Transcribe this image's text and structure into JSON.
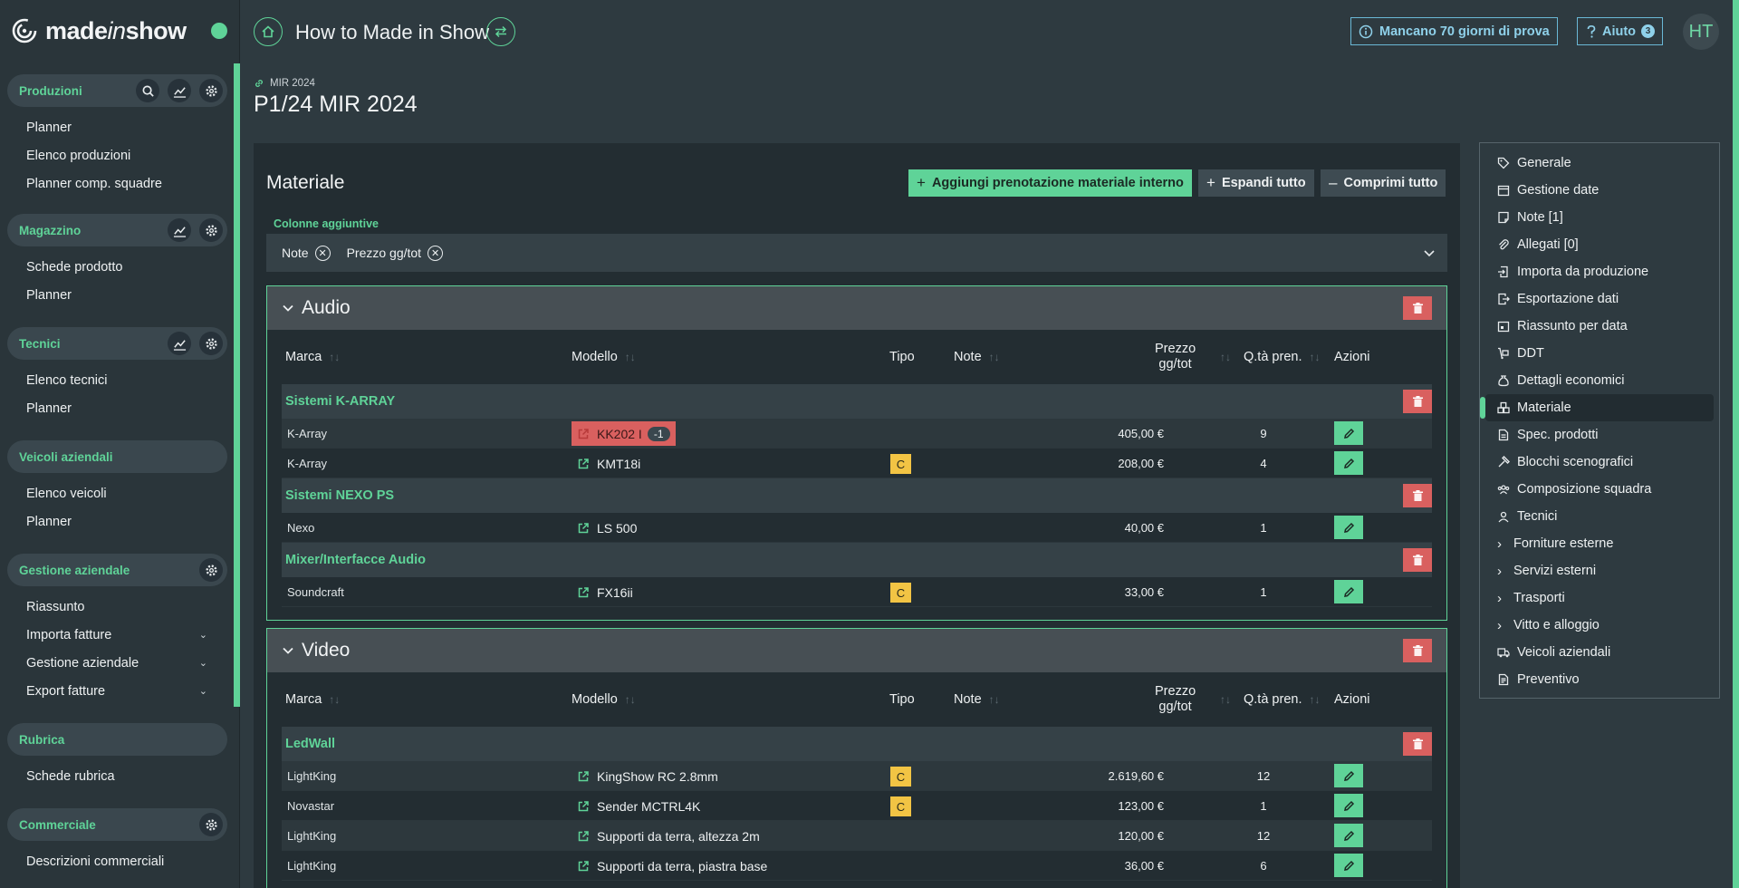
{
  "brand": {
    "name_part1": "made",
    "name_italic": "in",
    "name_part2": "show"
  },
  "topbar": {
    "title": "How to Made in Show",
    "trial_text": "Mancano 70 giorni di prova",
    "help_label": "Aiuto",
    "help_count": "3",
    "avatar_initials": "HT"
  },
  "sidebar": {
    "groups": [
      {
        "title": "Produzioni",
        "items": [
          "Planner",
          "Elenco produzioni",
          "Planner comp. squadre"
        ]
      },
      {
        "title": "Magazzino",
        "items": [
          "Schede prodotto",
          "Planner"
        ]
      },
      {
        "title": "Tecnici",
        "items": [
          "Elenco tecnici",
          "Planner"
        ]
      },
      {
        "title": "Veicoli aziendali",
        "items": [
          "Elenco veicoli",
          "Planner"
        ]
      },
      {
        "title": "Gestione aziendale",
        "items": [
          "Riassunto",
          "Importa fatture",
          "Gestione aziendale",
          "Export fatture"
        ]
      },
      {
        "title": "Rubrica",
        "items": [
          "Schede rubrica"
        ]
      },
      {
        "title": "Commerciale",
        "items": [
          "Descrizioni commerciali"
        ]
      }
    ]
  },
  "page": {
    "breadcrumb": "MIR 2024",
    "title": "P1/24 MIR 2024"
  },
  "main": {
    "title": "Materiale",
    "add_button": "Aggiungi prenotazione materiale interno",
    "expand_button": "Espandi tutto",
    "collapse_button": "Comprimi tutto",
    "columns_label": "Colonne aggiuntive",
    "columns": [
      "Note",
      "Prezzo gg/tot"
    ]
  },
  "table_headers": {
    "marca": "Marca",
    "modello": "Modello",
    "tipo": "Tipo",
    "note": "Note",
    "prezzo_line1": "Prezzo",
    "prezzo_line2": "gg/tot",
    "qta": "Q.tà pren.",
    "azioni": "Azioni"
  },
  "sections": [
    {
      "title": "Audio",
      "groups": [
        {
          "name": "Sistemi K-ARRAY",
          "rows": [
            {
              "brand": "K-Array",
              "model": "KK202 I",
              "warn": "-1",
              "tipo": "",
              "price": "405,00 €",
              "qty": "9"
            },
            {
              "brand": "K-Array",
              "model": "KMT18i",
              "tipo": "C",
              "price": "208,00 €",
              "qty": "4"
            }
          ]
        },
        {
          "name": "Sistemi NEXO PS",
          "rows": [
            {
              "brand": "Nexo",
              "model": "LS 500",
              "tipo": "",
              "price": "40,00 €",
              "qty": "1"
            }
          ]
        },
        {
          "name": "Mixer/Interfacce Audio",
          "rows": [
            {
              "brand": "Soundcraft",
              "model": "FX16ii",
              "tipo": "C",
              "price": "33,00 €",
              "qty": "1"
            }
          ]
        }
      ]
    },
    {
      "title": "Video",
      "groups": [
        {
          "name": "LedWall",
          "rows": [
            {
              "brand": "LightKing",
              "model": "KingShow RC 2.8mm",
              "tipo": "C",
              "price": "2.619,60 €",
              "qty": "12"
            },
            {
              "brand": "Novastar",
              "model": "Sender MCTRL4K",
              "tipo": "C",
              "price": "123,00 €",
              "qty": "1"
            },
            {
              "brand": "LightKing",
              "model": "Supporti da terra, altezza 2m",
              "tipo": "",
              "price": "120,00 €",
              "qty": "12"
            },
            {
              "brand": "LightKing",
              "model": "Supporti da terra, piastra base",
              "tipo": "",
              "price": "36,00 €",
              "qty": "6"
            }
          ]
        }
      ]
    }
  ],
  "right_nav": [
    {
      "label": "Generale",
      "icon": "tag-icon"
    },
    {
      "label": "Gestione date",
      "icon": "calendar-icon"
    },
    {
      "label": "Note [1]",
      "icon": "note-icon"
    },
    {
      "label": "Allegati [0]",
      "icon": "paperclip-icon"
    },
    {
      "label": "Importa da produzione",
      "icon": "import-icon"
    },
    {
      "label": "Esportazione dati",
      "icon": "export-icon"
    },
    {
      "label": "Riassunto per data",
      "icon": "calendar-summary-icon"
    },
    {
      "label": "DDT",
      "icon": "dolly-icon"
    },
    {
      "label": "Dettagli economici",
      "icon": "moneybag-icon"
    },
    {
      "label": "Materiale",
      "icon": "boxes-icon",
      "active": true
    },
    {
      "label": "Spec. prodotti",
      "icon": "document-icon"
    },
    {
      "label": "Blocchi scenografici",
      "icon": "hammer-icon"
    },
    {
      "label": "Composizione squadra",
      "icon": "team-icon"
    },
    {
      "label": "Tecnici",
      "icon": "worker-icon"
    },
    {
      "label": "Forniture esterne",
      "icon": "chevron-right-icon"
    },
    {
      "label": "Servizi esterni",
      "icon": "chevron-right-icon"
    },
    {
      "label": "Trasporti",
      "icon": "chevron-right-icon"
    },
    {
      "label": "Vitto e alloggio",
      "icon": "chevron-right-icon"
    },
    {
      "label": "Veicoli aziendali",
      "icon": "truck-icon"
    },
    {
      "label": "Preventivo",
      "icon": "invoice-icon"
    }
  ],
  "colors": {
    "accent": "#5fd398",
    "danger": "#d9605f",
    "warning": "#f2c444",
    "info": "#8fd1ea"
  }
}
